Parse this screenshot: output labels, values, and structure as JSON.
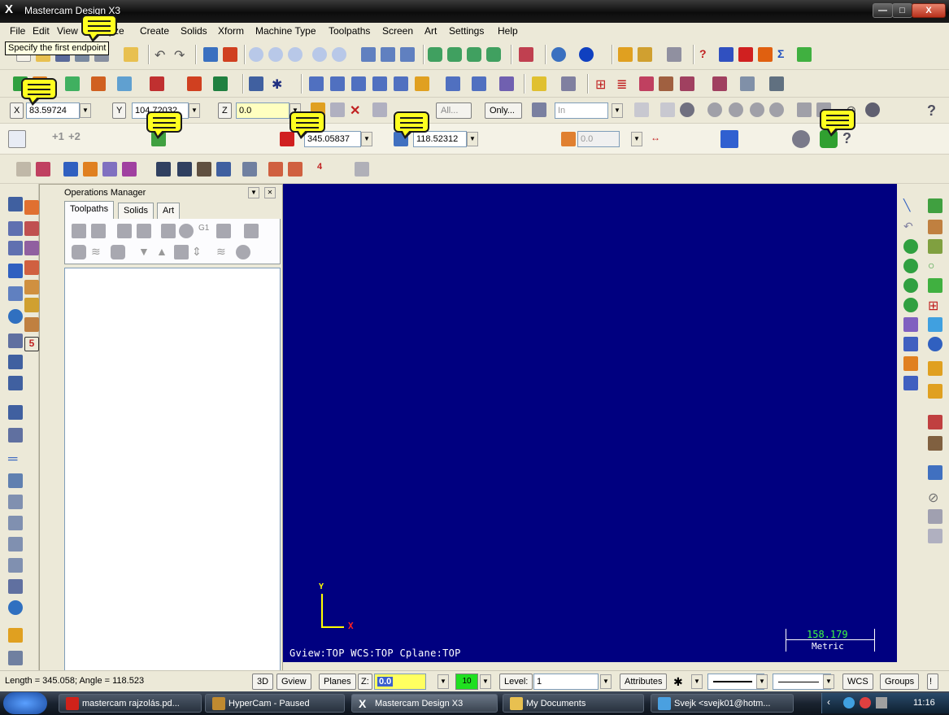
{
  "window": {
    "title": "Mastercam Design X3",
    "app_glyph": "X",
    "min_label": "—",
    "max_label": "□",
    "close_label": "X"
  },
  "menu": [
    "File",
    "Edit",
    "View",
    "Analyze",
    "Create",
    "Solids",
    "Xform",
    "Machine Type",
    "Toolpaths",
    "Screen",
    "Art",
    "Settings",
    "Help"
  ],
  "tooltip": "Specify the first endpoint",
  "coords": {
    "x_label": "X",
    "x_value": "83.59724",
    "y_label": "Y",
    "y_value": "104.72032",
    "z_label": "Z",
    "z_value": "0.0",
    "all_label": "All...",
    "only_label": "Only...",
    "in_label": "In"
  },
  "ribbon": {
    "length_value": "345.05837",
    "angle_value": "118.52312",
    "third_value": "0.0",
    "plus1": "+1",
    "plus2": "+2"
  },
  "ops_manager": {
    "title": "Operations Manager",
    "tabs": [
      "Toolpaths",
      "Solids",
      "Art"
    ],
    "g1_label": "G1"
  },
  "viewport": {
    "axis_y": "Y",
    "axis_x": "X",
    "view_info": "Gview:TOP   WCS:TOP   Cplane:TOP",
    "scale_value": "158.179",
    "scale_unit": "Metric",
    "background_color": "#000080"
  },
  "status": {
    "prompt": "Length = 345.058; Angle = 118.523",
    "btn_3d": "3D",
    "btn_gview": "Gview",
    "btn_planes": "Planes",
    "z_label": "Z:",
    "z_value": "0.0",
    "color_value": "10",
    "level_label": "Level:",
    "level_value": "1",
    "attributes_label": "Attributes",
    "wcs_label": "WCS",
    "groups_label": "Groups"
  },
  "taskbar": {
    "items": [
      {
        "label": "mastercam rajzolás.pd...",
        "icon_color": "#d0221a"
      },
      {
        "label": "HyperCam - Paused",
        "icon_color": "#c08a30"
      },
      {
        "label": "Mastercam Design X3",
        "icon_color": "#e0e0e0"
      },
      {
        "label": "My Documents",
        "icon_color": "#e8c050"
      },
      {
        "label": "Svejk <svejk01@hotm...",
        "icon_color": "#4aa0e0"
      }
    ],
    "clock": "11:16"
  }
}
